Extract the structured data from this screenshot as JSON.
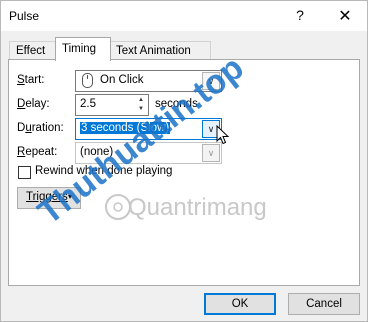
{
  "window": {
    "title": "Pulse",
    "help_glyph": "?",
    "close_glyph": "✕"
  },
  "tabs": [
    {
      "label": "Effect",
      "active": false
    },
    {
      "label": "Timing",
      "active": true
    },
    {
      "label": "Text Animation",
      "active": false
    }
  ],
  "form": {
    "start": {
      "label": "Start:",
      "value": "On Click",
      "icon": "mouse-icon"
    },
    "delay": {
      "label": "Delay:",
      "value": "2.5",
      "unit": "seconds"
    },
    "duration": {
      "label": "Duration:",
      "value": "3 seconds (Slow)"
    },
    "repeat": {
      "label": "Repeat:",
      "value": "(none)"
    },
    "rewind": {
      "label": "Rewind when done playing",
      "checked": false
    },
    "triggers": {
      "label": "Triggers",
      "arrow_glyph": "▾"
    }
  },
  "footer": {
    "ok_label": "OK",
    "cancel_label": "Cancel"
  },
  "watermark": {
    "text1": "Thuthuattin.top",
    "text2": "Quantrimang"
  },
  "glyphs": {
    "dropdown": "∨",
    "spin_up": "▲",
    "spin_down": "▼"
  },
  "colors": {
    "accent": "#0078d7",
    "watermark_orange": "#e8531f",
    "watermark_blue": "#1a72c8"
  }
}
